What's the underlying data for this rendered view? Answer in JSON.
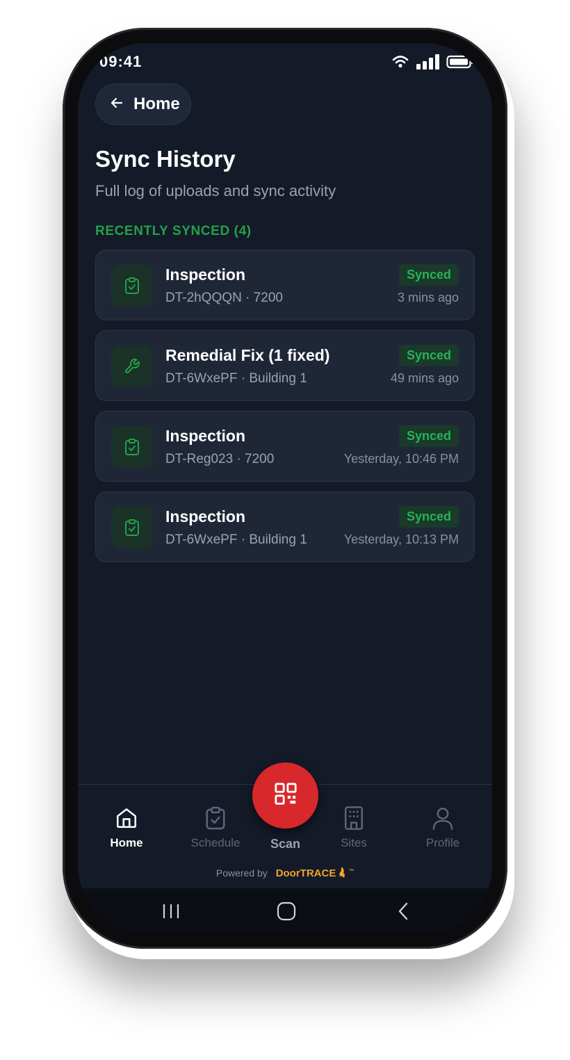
{
  "status_bar": {
    "time": "09:41"
  },
  "header": {
    "back_label": "Home",
    "title": "Sync History",
    "subtitle": "Full log of uploads and sync activity"
  },
  "section": {
    "label": "RECENTLY SYNCED (4)"
  },
  "items": [
    {
      "icon": "clipboard-check-icon",
      "name": "Inspection",
      "meta": "DT-2hQQQN · 7200",
      "status": "Synced",
      "when": "3 mins ago"
    },
    {
      "icon": "wrench-icon",
      "name": "Remedial Fix (1 fixed)",
      "meta": "DT-6WxePF · Building 1",
      "status": "Synced",
      "when": "49 mins ago"
    },
    {
      "icon": "clipboard-check-icon",
      "name": "Inspection",
      "meta": "DT-Reg023 · 7200",
      "status": "Synced",
      "when": "Yesterday, 10:46 PM"
    },
    {
      "icon": "clipboard-check-icon",
      "name": "Inspection",
      "meta": "DT-6WxePF · Building 1",
      "status": "Synced",
      "when": "Yesterday, 10:13 PM"
    }
  ],
  "nav": {
    "home": "Home",
    "schedule": "Schedule",
    "scan": "Scan",
    "sites": "Sites",
    "profile": "Profile",
    "active": "Home"
  },
  "footer": {
    "powered_by": "Powered by",
    "brand": "DoorTRACE",
    "tm": "™"
  },
  "colors": {
    "background": "#141a28",
    "card": "#1f2737",
    "accent_green": "#22a24a",
    "scan_red": "#d8282b",
    "brand_orange": "#f0a32a"
  }
}
